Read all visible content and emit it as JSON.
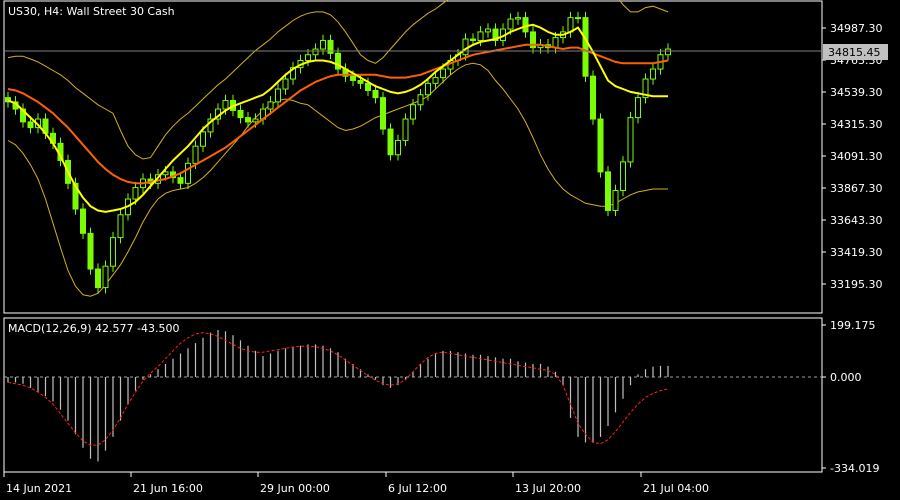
{
  "chart_data": [
    {
      "type": "candlestick",
      "title": "US30, H4:  Wall Street 30 Cash",
      "current_price": "34815.45",
      "y_ticks": [
        "34987.30",
        "34763.30",
        "34539.30",
        "34315.30",
        "34091.30",
        "33867.30",
        "33643.30",
        "33419.30",
        "33195.30"
      ],
      "ylim": [
        33120,
        35300
      ],
      "x_ticks": [
        "14 Jun 2021",
        "21 Jun 16:00",
        "29 Jun 00:00",
        "6 Jul 12:00",
        "13 Jul 20:00",
        "21 Jul 04:00"
      ],
      "close": [
        34470,
        34420,
        34330,
        34290,
        34350,
        34250,
        34180,
        34060,
        33900,
        33720,
        33550,
        33300,
        33170,
        33320,
        33520,
        33680,
        33790,
        33870,
        33930,
        33900,
        33960,
        33980,
        33940,
        33900,
        34040,
        34160,
        34260,
        34350,
        34420,
        34480,
        34410,
        34360,
        34330,
        34350,
        34420,
        34470,
        34560,
        34630,
        34710,
        34760,
        34800,
        34840,
        34900,
        34810,
        34700,
        34650,
        34620,
        34600,
        34550,
        34500,
        34280,
        34100,
        34200,
        34350,
        34450,
        34520,
        34600,
        34640,
        34700,
        34760,
        34800,
        34910,
        34900,
        34960,
        34980,
        34900,
        34980,
        35050,
        35060,
        34960,
        34850,
        34870,
        34850,
        34920,
        34960,
        35060,
        35060,
        34650,
        34350,
        33980,
        33710,
        33850,
        34050,
        34360,
        34500,
        34630,
        34700,
        34800,
        34840
      ],
      "series": [
        {
          "name": "MA fast",
          "color": "#ffff00",
          "values": [
            34480,
            34460,
            34410,
            34360,
            34310,
            34250,
            34180,
            34090,
            33980,
            33880,
            33800,
            33740,
            33710,
            33700,
            33710,
            33720,
            33740,
            33770,
            33820,
            33880,
            33940,
            34000,
            34060,
            34110,
            34160,
            34220,
            34280,
            34330,
            34370,
            34410,
            34440,
            34460,
            34480,
            34500,
            34520,
            34560,
            34610,
            34660,
            34700,
            34730,
            34750,
            34760,
            34760,
            34750,
            34730,
            34700,
            34670,
            34640,
            34610,
            34580,
            34560,
            34540,
            34530,
            34540,
            34560,
            34590,
            34630,
            34680,
            34720,
            34760,
            34800,
            34840,
            34870,
            34890,
            34900,
            34910,
            34930,
            34960,
            34980,
            35000,
            35010,
            34990,
            34960,
            34940,
            34940,
            34960,
            34990,
            34910,
            34820,
            34720,
            34620,
            34580,
            34560,
            34540,
            34530,
            34520,
            34510,
            34510,
            34510
          ]
        },
        {
          "name": "MA slow",
          "color": "#ff6000",
          "values": [
            34560,
            34550,
            34530,
            34500,
            34470,
            34430,
            34390,
            34340,
            34290,
            34230,
            34170,
            34110,
            34050,
            34000,
            33960,
            33930,
            33910,
            33900,
            33900,
            33910,
            33920,
            33930,
            33950,
            33970,
            34000,
            34030,
            34060,
            34090,
            34120,
            34150,
            34190,
            34230,
            34270,
            34310,
            34350,
            34390,
            34430,
            34470,
            34510,
            34550,
            34580,
            34610,
            34630,
            34650,
            34660,
            34660,
            34660,
            34660,
            34660,
            34660,
            34650,
            34640,
            34640,
            34640,
            34650,
            34660,
            34680,
            34700,
            34720,
            34740,
            34760,
            34780,
            34800,
            34810,
            34820,
            34830,
            34840,
            34850,
            34860,
            34870,
            34870,
            34870,
            34860,
            34850,
            34840,
            34850,
            34850,
            34830,
            34810,
            34790,
            34770,
            34750,
            34740,
            34740,
            34740,
            34740,
            34740,
            34750,
            34760
          ]
        },
        {
          "name": "BB upper",
          "color": "#d4b01e",
          "values": [
            34780,
            34790,
            34790,
            34770,
            34750,
            34720,
            34690,
            34660,
            34620,
            34570,
            34530,
            34490,
            34450,
            34420,
            34390,
            34270,
            34160,
            34100,
            34070,
            34080,
            34160,
            34240,
            34300,
            34350,
            34390,
            34440,
            34490,
            34540,
            34590,
            34630,
            34680,
            34730,
            34780,
            34830,
            34870,
            34910,
            34960,
            35000,
            35040,
            35070,
            35090,
            35100,
            35100,
            35080,
            35030,
            34960,
            34880,
            34800,
            34760,
            34740,
            34780,
            34840,
            34900,
            34960,
            35010,
            35050,
            35090,
            35120,
            35160,
            35200,
            35240,
            35270,
            35280,
            35260,
            35240,
            35220,
            35250,
            35290,
            35330,
            35330,
            35300,
            35260,
            35220,
            35200,
            35200,
            35240,
            35300,
            35380,
            35400,
            35380,
            35300,
            35220,
            35150,
            35100,
            35100,
            35130,
            35140,
            35120,
            35100
          ]
        },
        {
          "name": "BB lower",
          "color": "#d4b01e",
          "values": [
            34200,
            34170,
            34110,
            34030,
            33930,
            33790,
            33620,
            33450,
            33290,
            33180,
            33120,
            33110,
            33130,
            33190,
            33260,
            33330,
            33420,
            33520,
            33630,
            33720,
            33790,
            33830,
            33850,
            33860,
            33870,
            33900,
            33940,
            33990,
            34050,
            34110,
            34170,
            34230,
            34300,
            34360,
            34410,
            34450,
            34480,
            34490,
            34480,
            34460,
            34450,
            34410,
            34370,
            34330,
            34290,
            34270,
            34280,
            34300,
            34330,
            34360,
            34380,
            34400,
            34420,
            34440,
            34460,
            34480,
            34510,
            34560,
            34610,
            34660,
            34700,
            34730,
            34740,
            34730,
            34690,
            34620,
            34560,
            34490,
            34420,
            34330,
            34220,
            34100,
            34000,
            33920,
            33860,
            33820,
            33790,
            33760,
            33750,
            33740,
            33740,
            33760,
            33790,
            33820,
            33840,
            33850,
            33860,
            33860,
            33860
          ]
        }
      ]
    },
    {
      "type": "histogram",
      "title": "MACD(12,26,9) 42.577 -43.500",
      "y_ticks": [
        "199.175",
        "0.000",
        "-334.019"
      ],
      "ylim": [
        -334.019,
        199.175
      ],
      "macd": [
        -20,
        -20,
        -25,
        -40,
        -55,
        -70,
        -90,
        -120,
        -160,
        -210,
        -260,
        -300,
        -310,
        -270,
        -220,
        -160,
        -100,
        -50,
        -10,
        10,
        30,
        50,
        70,
        90,
        110,
        130,
        150,
        170,
        180,
        175,
        160,
        140,
        120,
        100,
        80,
        90,
        100,
        110,
        115,
        120,
        125,
        125,
        120,
        110,
        95,
        70,
        50,
        30,
        10,
        -10,
        -30,
        -40,
        -30,
        -10,
        20,
        50,
        70,
        90,
        100,
        100,
        95,
        90,
        85,
        85,
        80,
        75,
        70,
        70,
        60,
        55,
        50,
        50,
        40,
        20,
        -30,
        -150,
        -220,
        -240,
        -240,
        -220,
        -180,
        -130,
        -80,
        -30,
        10,
        30,
        40,
        42.577,
        42.577
      ],
      "signal": [
        -20,
        -25,
        -30,
        -40,
        -55,
        -75,
        -100,
        -135,
        -170,
        -205,
        -235,
        -250,
        -250,
        -230,
        -195,
        -150,
        -100,
        -55,
        -15,
        15,
        40,
        70,
        100,
        130,
        150,
        165,
        170,
        165,
        155,
        140,
        125,
        110,
        100,
        95,
        95,
        100,
        105,
        110,
        115,
        118,
        118,
        116,
        110,
        100,
        85,
        65,
        45,
        25,
        5,
        -12,
        -25,
        -30,
        -25,
        -10,
        20,
        50,
        75,
        90,
        95,
        90,
        85,
        80,
        75,
        70,
        65,
        60,
        55,
        50,
        45,
        40,
        35,
        30,
        25,
        10,
        -30,
        -100,
        -170,
        -210,
        -240,
        -245,
        -230,
        -200,
        -165,
        -130,
        -100,
        -75,
        -60,
        -50,
        -43.5
      ]
    }
  ]
}
